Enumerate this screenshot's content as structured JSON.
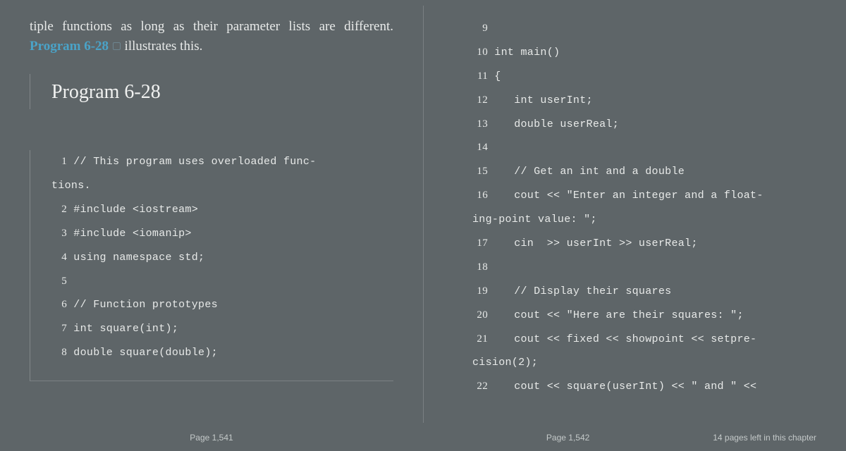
{
  "left": {
    "bodyPre": "tiple functions as long as their parameter lists are different. ",
    "linkText": "Program 6-28",
    "bodyPost": " illustrates this.",
    "heading": "Program 6-28",
    "codeLines": [
      {
        "n": "1",
        "t": " // This program uses overloaded func-",
        "wrap": "tions."
      },
      {
        "n": "2",
        "t": " #include <iostream>"
      },
      {
        "n": "3",
        "t": " #include <iomanip>"
      },
      {
        "n": "4",
        "t": " using namespace std;"
      },
      {
        "n": "5",
        "t": ""
      },
      {
        "n": "6",
        "t": " // Function prototypes"
      },
      {
        "n": "7",
        "t": " int square(int);"
      },
      {
        "n": "8",
        "t": " double square(double);"
      }
    ],
    "pageLabel": "Page 1,541"
  },
  "right": {
    "codeLines": [
      {
        "n": " 9",
        "t": ""
      },
      {
        "n": "10",
        "t": " int main()"
      },
      {
        "n": "11",
        "t": " {"
      },
      {
        "n": "12",
        "t": "    int userInt;"
      },
      {
        "n": "13",
        "t": "    double userReal;"
      },
      {
        "n": "14",
        "t": ""
      },
      {
        "n": "15",
        "t": "    // Get an int and a double"
      },
      {
        "n": "16",
        "t": "    cout << \"Enter an integer and a float-",
        "wrap": "ing-point value: \";"
      },
      {
        "n": "17",
        "t": "    cin  >> userInt >> userReal;"
      },
      {
        "n": "18",
        "t": ""
      },
      {
        "n": "19",
        "t": "    // Display their squares"
      },
      {
        "n": "20",
        "t": "    cout << \"Here are their squares: \";"
      },
      {
        "n": "21",
        "t": "    cout << fixed << showpoint << setpre-",
        "wrap": "cision(2);"
      },
      {
        "n": "22",
        "t": "    cout << square(userInt) << \" and \" <<"
      }
    ],
    "pageLabel": "Page 1,542",
    "pagesLeft": "14 pages left in this chapter"
  }
}
